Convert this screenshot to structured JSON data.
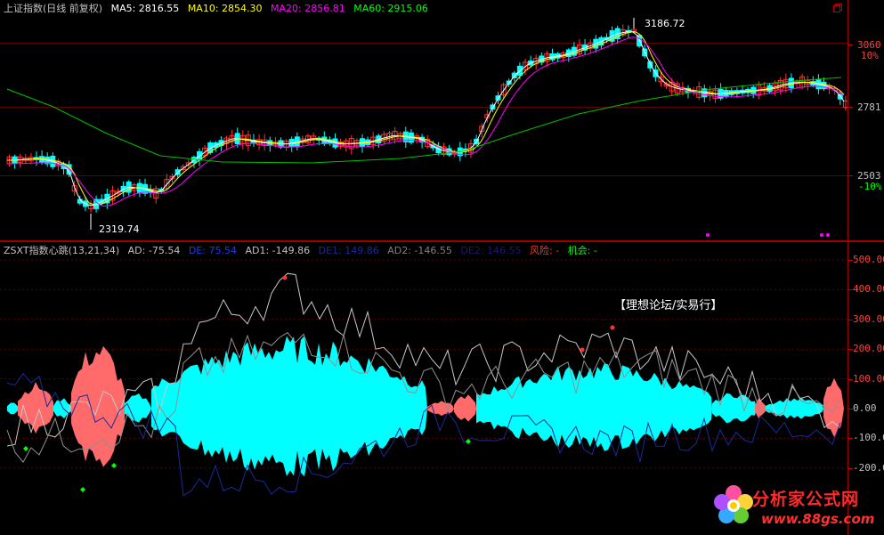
{
  "top": {
    "title": "上证指数(日线 前复权)",
    "ma5": "MA5: 2816.55",
    "ma10": "MA10: 2854.30",
    "ma20": "MA20: 2856.81",
    "ma60": "MA60: 2915.06",
    "high_label": "3186.72",
    "low_label": "2319.74",
    "axis": [
      {
        "value": "3060",
        "pct": "10%"
      },
      {
        "value": "2781",
        "pct": ""
      },
      {
        "value": "2503",
        "pct": "-10%"
      }
    ],
    "colors": {
      "ma5": "#ffffff",
      "ma10": "#ffff00",
      "ma20": "#ff00ff",
      "ma60": "#00ff00",
      "up": "#ff3232",
      "down": "#00ffff"
    }
  },
  "bottom": {
    "title": "ZSXT指数心跳(13,21,34)",
    "ad": "AD: -75.54",
    "de": "DE: 75.54",
    "ad1": "AD1: -149.86",
    "de1": "DE1: 149.86",
    "ad2": "AD2: -146.55",
    "de2": "DE2: 146.55",
    "risk": "风险: -",
    "chance": "机会: -",
    "axis": [
      "500.00",
      "400.00",
      "300.00",
      "200.00",
      "100.00",
      "0.00",
      "-100.00",
      "-200.00"
    ],
    "watermark": "【理想论坛/实易行】",
    "colors": {
      "pos": "#ff6a6a",
      "neg": "#00ffff",
      "risk": "#ff3232",
      "chance": "#00ff00"
    }
  },
  "logo": {
    "text": "分析家公式网",
    "url": "www.88gs.com"
  }
}
